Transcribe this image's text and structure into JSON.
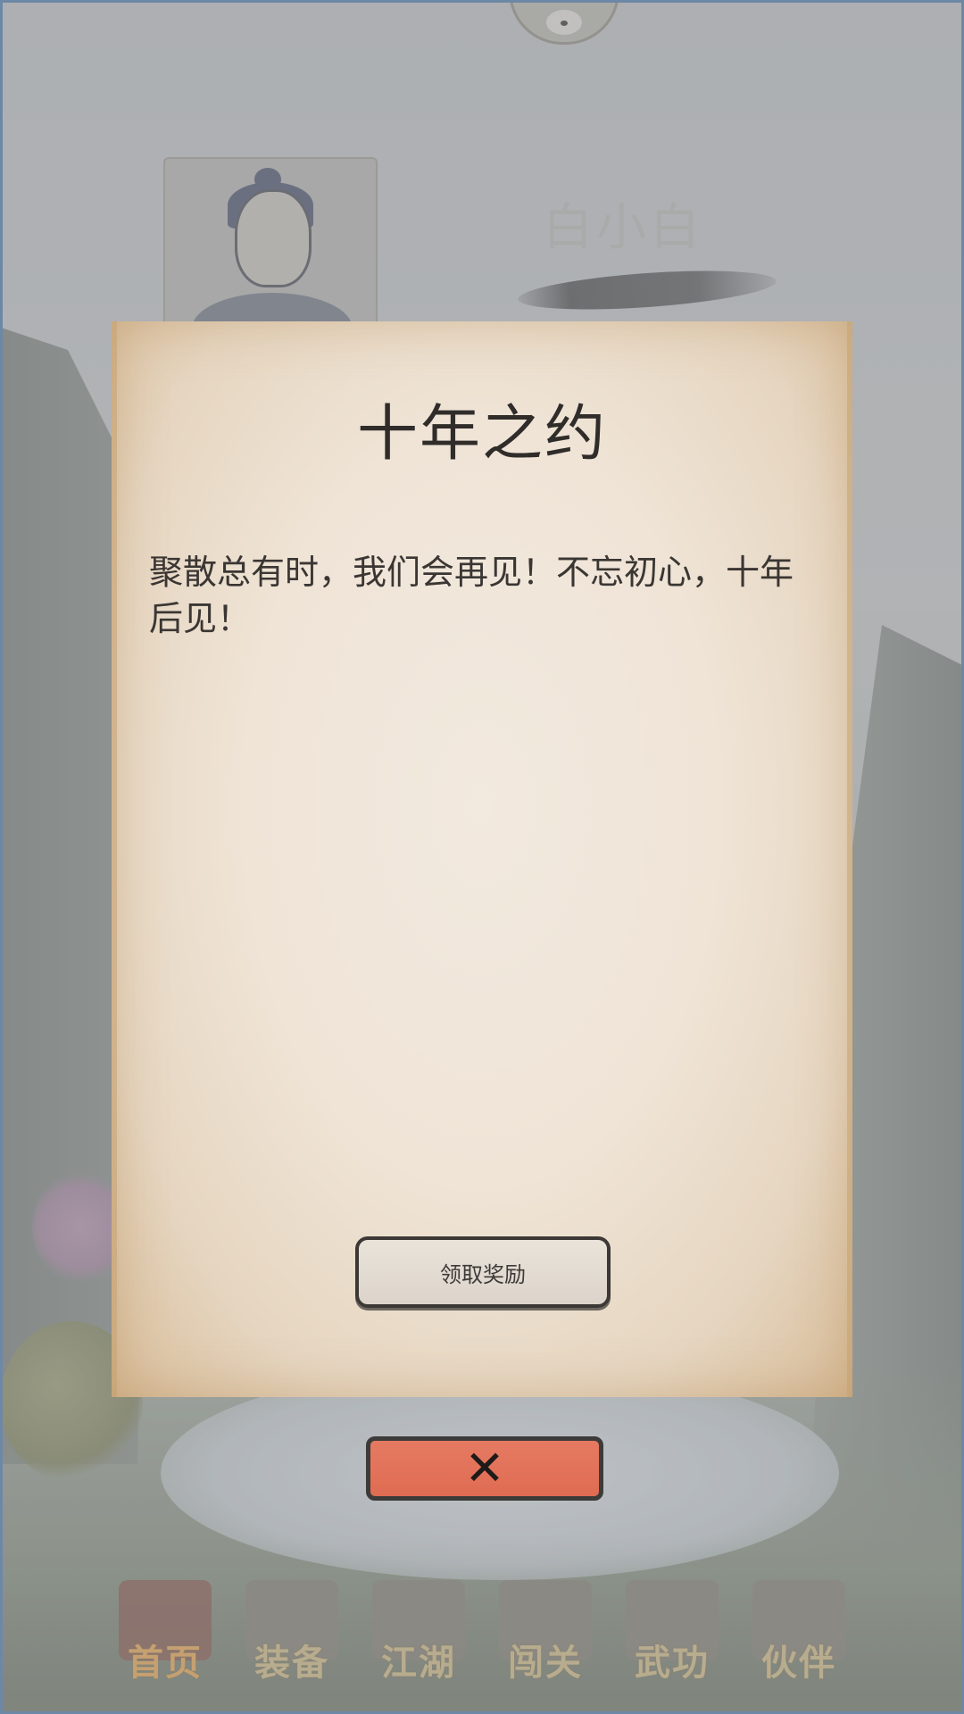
{
  "game": {
    "player_name": "白小白"
  },
  "popup": {
    "title": "十年之约",
    "message": "聚散总有时，我们会再见！不忘初心，十年后见！",
    "claim_button_label": "领取奖励",
    "close_icon": "close-x-icon"
  },
  "bottom_nav": {
    "items": [
      {
        "label": "首页",
        "icon": "home-pagoda-icon"
      },
      {
        "label": "装备",
        "icon": "armor-icon"
      },
      {
        "label": "江湖",
        "icon": "scroll-map-icon"
      },
      {
        "label": "闯关",
        "icon": "crossed-swords-icon"
      },
      {
        "label": "武功",
        "icon": "martial-book-icon"
      },
      {
        "label": "伙伴",
        "icon": "companions-icon"
      }
    ],
    "active_index": 0
  },
  "colors": {
    "close_button": "#e57a62",
    "parchment": "#efe4d6",
    "title_text": "#2f2c2a"
  }
}
